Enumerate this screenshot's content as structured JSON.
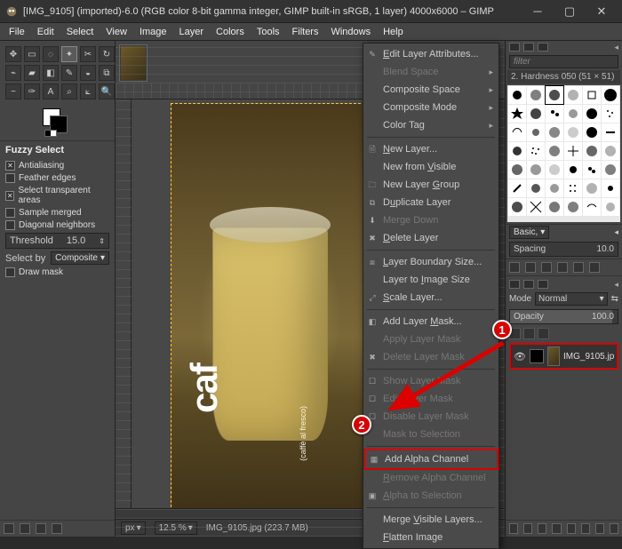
{
  "titlebar": {
    "title": "[IMG_9105] (imported)-6.0 (RGB color 8-bit gamma integer, GIMP built-in sRGB, 1 layer) 4000x6000 – GIMP"
  },
  "menubar": [
    "File",
    "Edit",
    "Select",
    "View",
    "Image",
    "Layer",
    "Colors",
    "Tools",
    "Filters",
    "Windows",
    "Help"
  ],
  "tool_options": {
    "title": "Fuzzy Select",
    "antialiasing": "Antialiasing",
    "feather": "Feather edges",
    "transparent": "Select transparent areas",
    "sample_merged": "Sample merged",
    "diagonal": "Diagonal neighbors",
    "threshold_label": "Threshold",
    "threshold_value": "15.0",
    "selectby_label": "Select by",
    "selectby_value": "Composite",
    "drawmask": "Draw mask"
  },
  "statusbar": {
    "unit": "px",
    "zoom": "12.5 %",
    "file": "IMG_9105.jpg (223.7 MB)"
  },
  "brushpanel": {
    "filter_placeholder": "filter",
    "name": "2. Hardness 050 (51 × 51)",
    "preset_label": "Basic,",
    "spacing_label": "Spacing",
    "spacing_value": "10.0"
  },
  "layerspanel": {
    "mode_label": "Mode",
    "mode_value": "Normal",
    "opacity_label": "Opacity",
    "opacity_value": "100.0",
    "layer_name": "IMG_9105.jp"
  },
  "context_menu": {
    "items": [
      {
        "label": "Edit Layer Attributes...",
        "underline": "E",
        "enabled": true,
        "icon": "edit"
      },
      {
        "label": "Blend Space",
        "enabled": false,
        "submenu": true
      },
      {
        "label": "Composite Space",
        "enabled": true,
        "submenu": true
      },
      {
        "label": "Composite Mode",
        "enabled": true,
        "submenu": true
      },
      {
        "label": "Color Tag",
        "enabled": true,
        "submenu": true
      },
      {
        "sep": true
      },
      {
        "label": "New Layer...",
        "underline": "N",
        "enabled": true,
        "icon": "doc"
      },
      {
        "label": "New from Visible",
        "underline": "V",
        "enabled": true
      },
      {
        "label": "New Layer Group",
        "underline": "G",
        "enabled": true,
        "icon": "folder"
      },
      {
        "label": "Duplicate Layer",
        "underline": "u",
        "enabled": true,
        "icon": "dup"
      },
      {
        "label": "Merge Down",
        "enabled": false,
        "icon": "merge"
      },
      {
        "label": "Delete Layer",
        "underline": "D",
        "enabled": true,
        "icon": "del"
      },
      {
        "sep": true
      },
      {
        "label": "Layer Boundary Size...",
        "underline": "L",
        "enabled": true,
        "icon": "size"
      },
      {
        "label": "Layer to Image Size",
        "underline": "I",
        "enabled": true
      },
      {
        "label": "Scale Layer...",
        "underline": "S",
        "enabled": true,
        "icon": "scale"
      },
      {
        "sep": true
      },
      {
        "label": "Add Layer Mask...",
        "underline": "M",
        "enabled": true,
        "icon": "mask"
      },
      {
        "label": "Apply Layer Mask",
        "enabled": false
      },
      {
        "label": "Delete Layer Mask",
        "enabled": false,
        "icon": "del"
      },
      {
        "sep": true
      },
      {
        "label": "Show Layer Mask",
        "enabled": false,
        "icon": "check"
      },
      {
        "label": "Edit Layer Mask",
        "enabled": false,
        "icon": "check"
      },
      {
        "label": "Disable Layer Mask",
        "enabled": false,
        "icon": "check"
      },
      {
        "label": "Mask to Selection",
        "enabled": false
      },
      {
        "sep": true
      },
      {
        "label": "Add Alpha Channel",
        "enabled": true,
        "highlight": true,
        "icon": "alpha"
      },
      {
        "label": "Remove Alpha Channel",
        "underline": "R",
        "enabled": false
      },
      {
        "label": "Alpha to Selection",
        "underline": "A",
        "enabled": false,
        "icon": "sel"
      },
      {
        "sep": true
      },
      {
        "label": "Merge Visible Layers...",
        "underline": "V",
        "enabled": true
      },
      {
        "label": "Flatten Image",
        "underline": "F",
        "enabled": true
      }
    ]
  },
  "annotations": {
    "marker1": "1",
    "marker2": "2"
  },
  "canvas_text": {
    "brand": "caf",
    "sub": "(caffè al fresco)"
  }
}
